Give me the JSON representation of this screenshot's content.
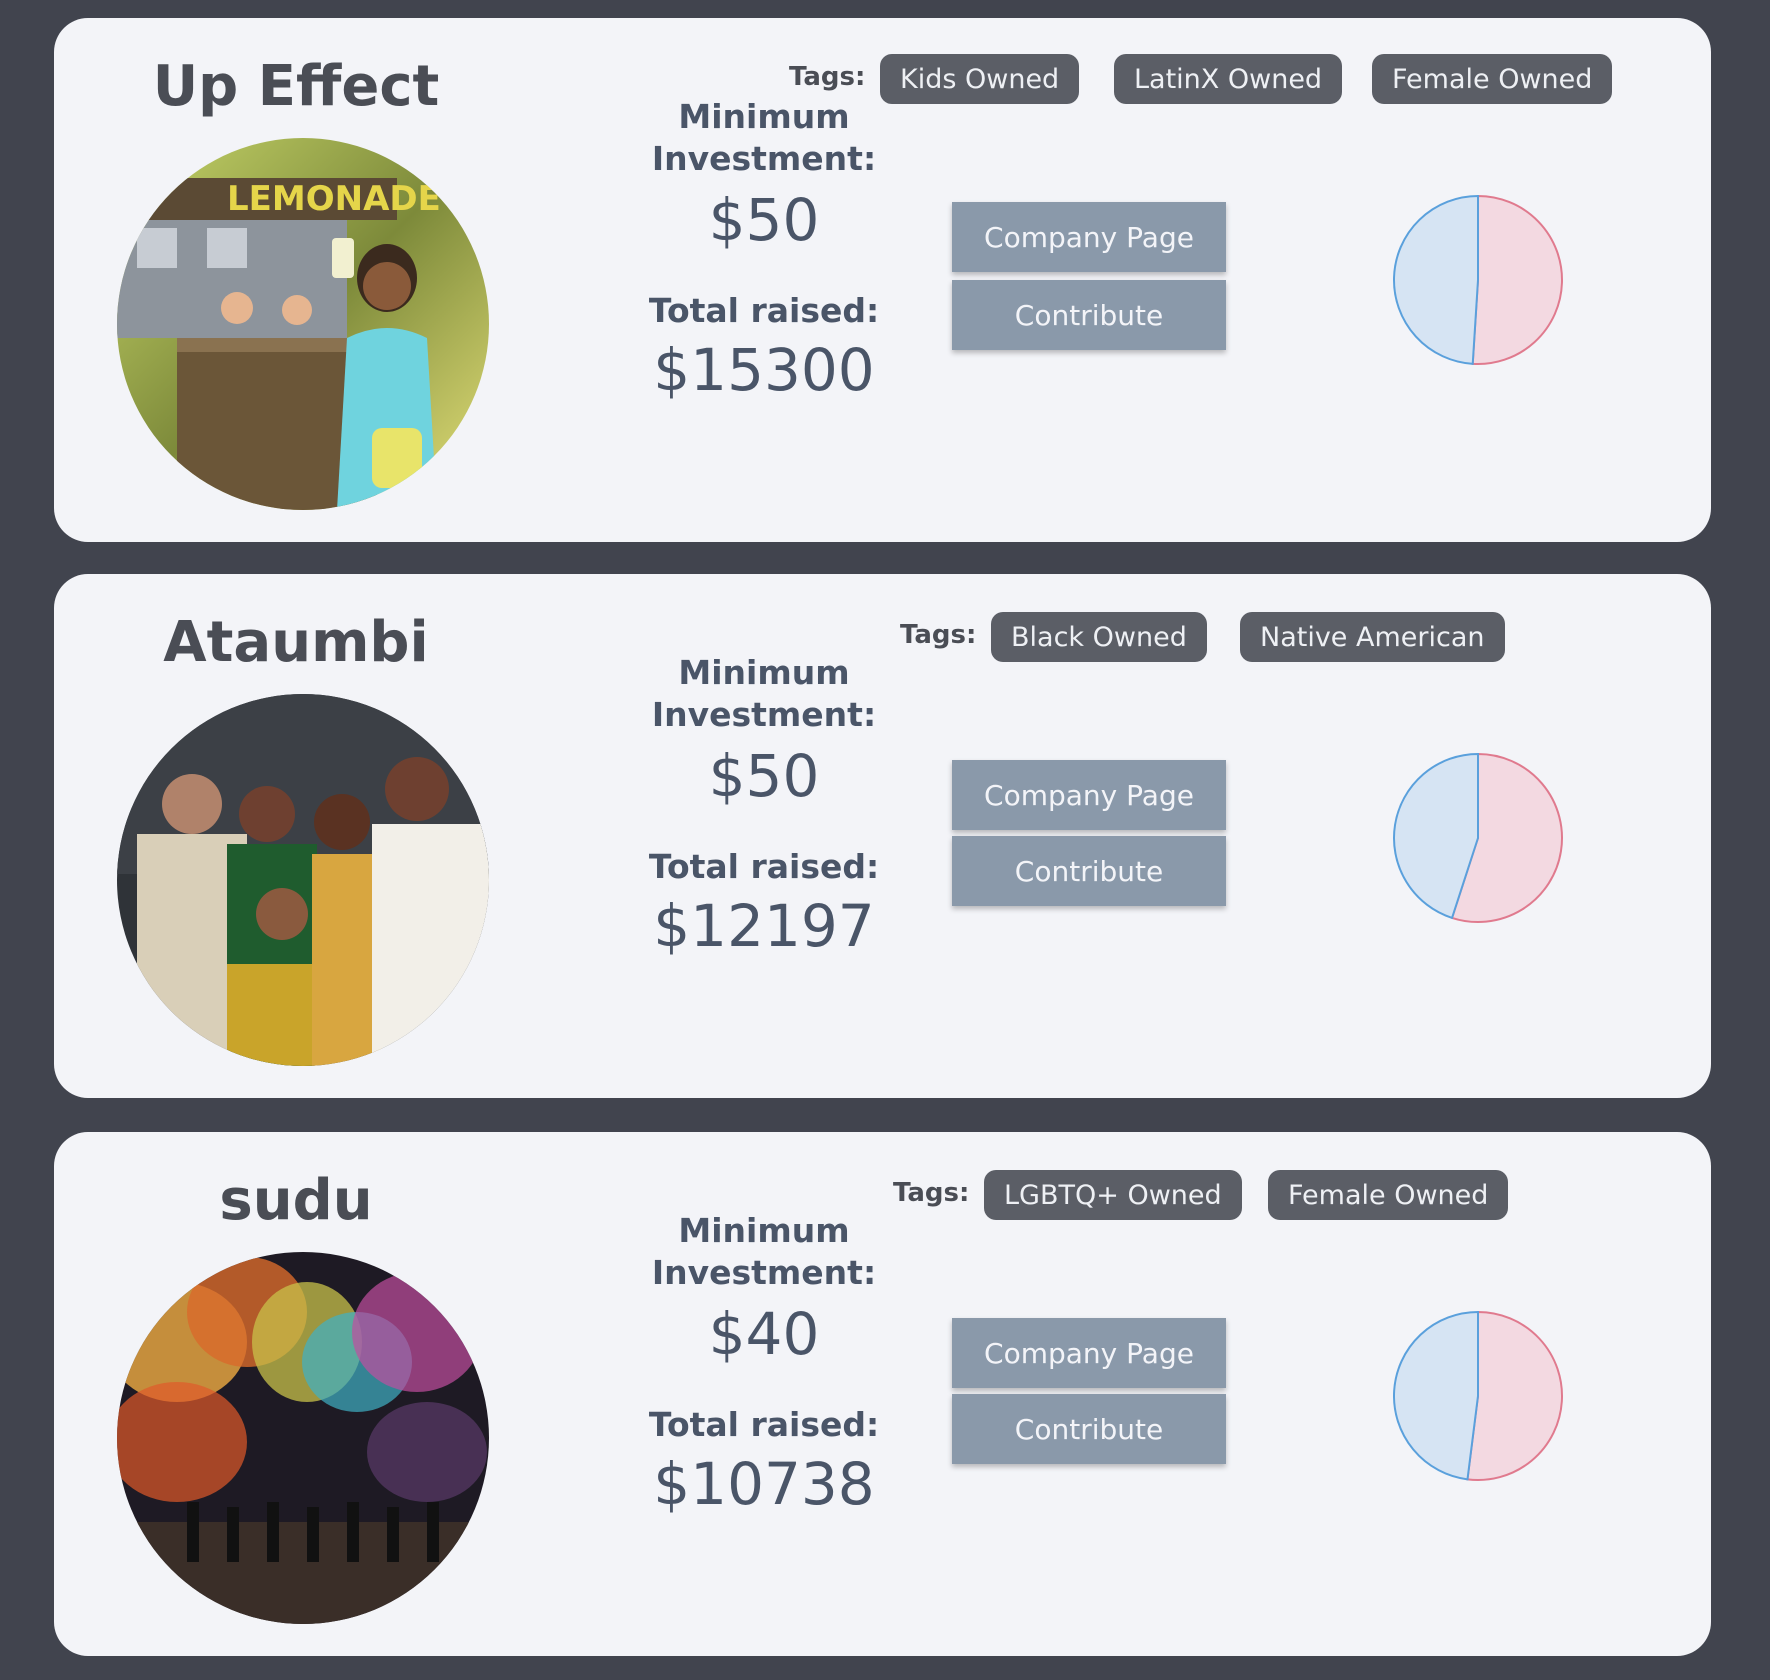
{
  "colors": {
    "background": "#41444e",
    "card": "#f3f4f8",
    "button": "#8a99aa",
    "tag": "#5b5e66",
    "pie_blue": "#5aa0dc",
    "pie_blue_fill": "#d6e4f3",
    "pie_pink": "#e07a8e",
    "pie_pink_fill": "#f3d9e1"
  },
  "cards": [
    {
      "name": "Up Effect",
      "image": "lemonade-stand-photo",
      "tags_label": "Tags:",
      "tags": [
        "Kids Owned",
        "LatinX Owned",
        "Female Owned"
      ],
      "min_investment_label": "Minimum Investment:",
      "min_investment": "$50",
      "total_raised_label": "Total raised:",
      "total_raised": "$15300",
      "company_page_label": "Company Page",
      "contribute_label": "Contribute",
      "pie": {
        "type": "pie",
        "slices": [
          {
            "color": "pink",
            "value": 0.51
          },
          {
            "color": "blue",
            "value": 0.49
          }
        ]
      }
    },
    {
      "name": "Ataumbi",
      "image": "family-portrait-photo",
      "tags_label": "Tags:",
      "tags": [
        "Black Owned",
        "Native American"
      ],
      "min_investment_label": "Minimum Investment:",
      "min_investment": "$50",
      "total_raised_label": "Total raised:",
      "total_raised": "$12197",
      "company_page_label": "Company Page",
      "contribute_label": "Contribute",
      "pie": {
        "type": "pie",
        "slices": [
          {
            "color": "pink",
            "value": 0.55
          },
          {
            "color": "blue",
            "value": 0.45
          }
        ]
      }
    },
    {
      "name": "sudu",
      "image": "colored-smoke-parade-photo",
      "tags_label": "Tags:",
      "tags": [
        "LGBTQ+ Owned",
        "Female Owned"
      ],
      "min_investment_label": "Minimum Investment:",
      "min_investment": "$40",
      "total_raised_label": "Total raised:",
      "total_raised": "$10738",
      "company_page_label": "Company Page",
      "contribute_label": "Contribute",
      "pie": {
        "type": "pie",
        "slices": [
          {
            "color": "pink",
            "value": 0.52
          },
          {
            "color": "blue",
            "value": 0.48
          }
        ]
      }
    }
  ]
}
